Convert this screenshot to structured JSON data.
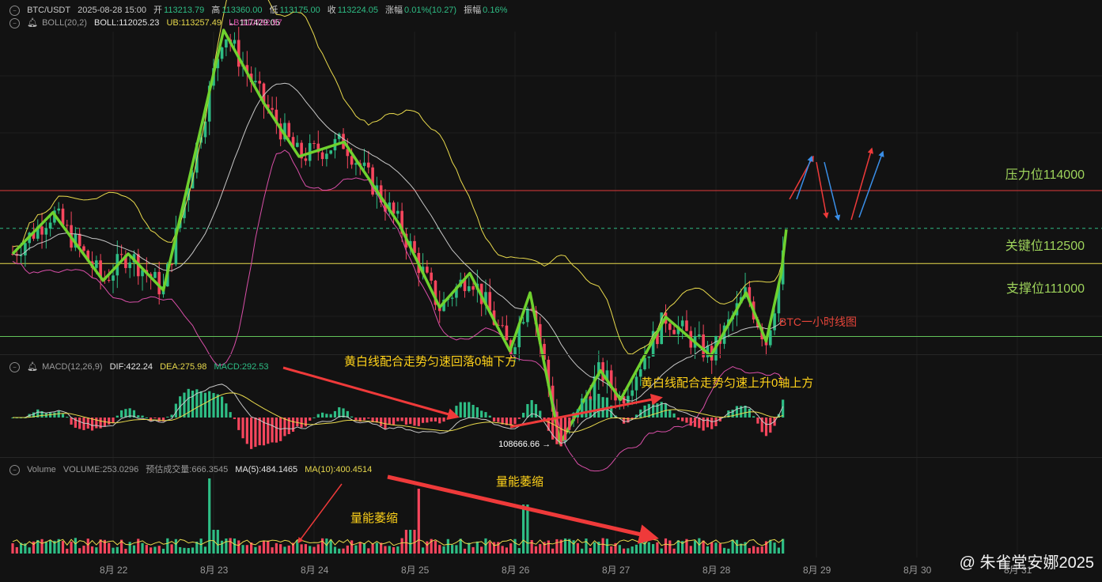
{
  "header": {
    "symbol": "BTC/USDT",
    "datetime": "2025-08-28 15:00",
    "open_label": "开",
    "open": "113213.79",
    "high_label": "高",
    "high": "113360.00",
    "low_label": "低",
    "low": "113175.00",
    "close_label": "收",
    "close": "113224.05",
    "change_label": "涨幅",
    "change": "0.01%(10.27)",
    "amp_label": "振幅",
    "amp": "0.16%"
  },
  "boll_header": {
    "name": "BOLL(20,2)",
    "boll": "BOLL:112025.23",
    "ub": "UB:113257.49",
    "lb": "LB:110792.97"
  },
  "macd_header": {
    "name": "MACD(12,26,9)",
    "dif": "DIF:422.24",
    "dea": "DEA:275.98",
    "macd": "MACD:292.53"
  },
  "vol_header": {
    "name": "Volume",
    "volume": "VOLUME:253.0296",
    "est": "预估成交量:666.3545",
    "ma5": "MA(5):484.1465",
    "ma10": "MA(10):400.4514"
  },
  "levels": {
    "resistance": "压力位114000",
    "key": "关键位112500",
    "support": "支撑位111000"
  },
  "annotations": {
    "chart_title": "BTC一小时线图",
    "macd_down": "黄白线配合走势匀速回落0轴下方",
    "macd_up": "黄白线配合走势匀速上升0轴上方",
    "vol_shrink_1": "量能萎缩",
    "vol_shrink_2": "量能萎缩",
    "high_mark": "117429.05",
    "low_mark": "108666.66"
  },
  "watermark": "@ 朱雀堂安娜2025",
  "colors": {
    "up": "#2ebd85",
    "down": "#f6465d",
    "wave": "#6fd12e",
    "ub": "#e8d94c",
    "lb": "#d94fa8",
    "mid": "#c8c8c8",
    "resistance": "#e03a3a",
    "key": "#e8d94c",
    "support": "#63c35a"
  },
  "chart_data": {
    "type": "candlestick",
    "title": "BTC一小时线图",
    "x_ticks": [
      "8月 22",
      "8月 23",
      "8月 24",
      "8月 25",
      "8月 26",
      "8月 27",
      "8月 28",
      "8月 29",
      "8月 30",
      "8月 31"
    ],
    "price_levels": {
      "resistance": 114000,
      "key": 112500,
      "support": 111000,
      "last": 113224.05
    },
    "wave_pivots": [
      {
        "day": 21.0,
        "price": 112700
      },
      {
        "day": 21.4,
        "price": 113550
      },
      {
        "day": 21.9,
        "price": 112150
      },
      {
        "day": 22.15,
        "price": 112700
      },
      {
        "day": 22.5,
        "price": 111950
      },
      {
        "day": 23.1,
        "price": 117300
      },
      {
        "day": 23.5,
        "price": 115800
      },
      {
        "day": 23.85,
        "price": 114700
      },
      {
        "day": 24.3,
        "price": 115000
      },
      {
        "day": 24.85,
        "price": 113300
      },
      {
        "day": 25.25,
        "price": 111600
      },
      {
        "day": 25.55,
        "price": 112300
      },
      {
        "day": 25.95,
        "price": 110700
      },
      {
        "day": 26.15,
        "price": 111900
      },
      {
        "day": 26.45,
        "price": 108800
      },
      {
        "day": 26.85,
        "price": 110300
      },
      {
        "day": 27.05,
        "price": 109700
      },
      {
        "day": 27.5,
        "price": 111400
      },
      {
        "day": 27.95,
        "price": 110600
      },
      {
        "day": 28.3,
        "price": 111900
      },
      {
        "day": 28.5,
        "price": 110900
      },
      {
        "day": 28.65,
        "price": 112300
      },
      {
        "day": 28.7,
        "price": 113200
      }
    ]
  }
}
